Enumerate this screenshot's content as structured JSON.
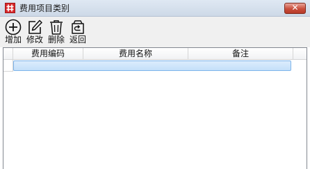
{
  "window": {
    "title": "费用项目类别",
    "close_glyph": "✕",
    "app_icon": "grid-app-icon"
  },
  "toolbar": {
    "items": [
      {
        "id": "add",
        "label": "增加",
        "icon": "plus-circle-icon"
      },
      {
        "id": "edit",
        "label": "修改",
        "icon": "edit-icon"
      },
      {
        "id": "delete",
        "label": "删除",
        "icon": "trash-icon"
      },
      {
        "id": "back",
        "label": "返回",
        "icon": "return-icon"
      }
    ]
  },
  "grid": {
    "columns": [
      "费用编码",
      "费用名称",
      "备注"
    ],
    "rows": [
      {
        "code": "",
        "name": "",
        "note": "",
        "selected": true
      }
    ]
  },
  "colors": {
    "title_bar": "#cdd9e7",
    "close_button": "#c94e3c",
    "selection": "#c4e0fa",
    "toolbar_bg": "#f0f0f0"
  }
}
